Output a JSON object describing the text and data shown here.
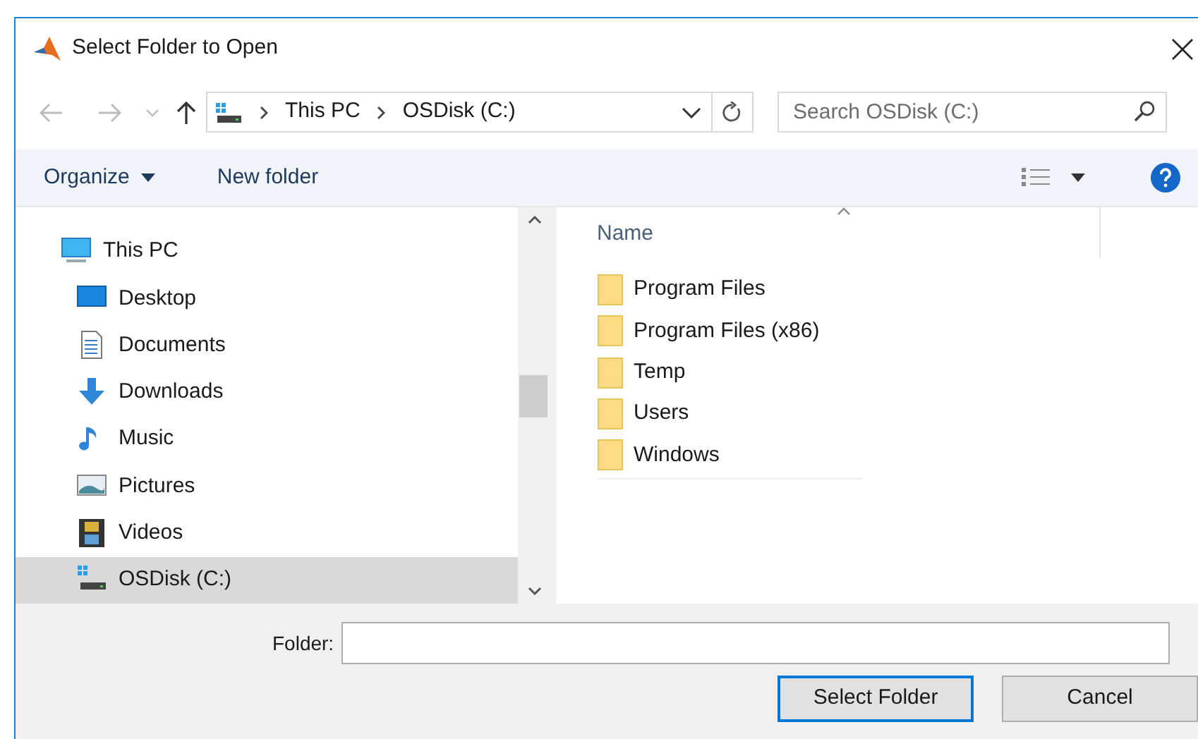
{
  "window": {
    "title": "Select Folder to Open"
  },
  "address_bar": {
    "path": [
      {
        "label": "This PC"
      },
      {
        "label": "OSDisk (C:)"
      }
    ]
  },
  "search": {
    "placeholder": "Search OSDisk (C:)"
  },
  "toolbar": {
    "buttons": [
      {
        "label": "Organize",
        "kind": "menu"
      },
      {
        "label": "New folder",
        "kind": "plain"
      }
    ]
  },
  "sidebar": {
    "items": [
      {
        "label": "This PC",
        "kind": "pc",
        "selected": false,
        "children": [
          {
            "label": "Desktop",
            "kind": "desktop",
            "selected": false
          },
          {
            "label": "Documents",
            "kind": "documents",
            "selected": false
          },
          {
            "label": "Downloads",
            "kind": "downloads",
            "selected": false
          },
          {
            "label": "Music",
            "kind": "music",
            "selected": false
          },
          {
            "label": "Pictures",
            "kind": "pictures",
            "selected": false
          },
          {
            "label": "Videos",
            "kind": "videos",
            "selected": false
          },
          {
            "label": "OSDisk (C:)",
            "kind": "disk",
            "selected": true
          }
        ]
      }
    ]
  },
  "file_list": {
    "columns": [
      "Name"
    ],
    "rows": [
      {
        "name": "Program Files"
      },
      {
        "name": "Program Files (x86)"
      },
      {
        "name": "Temp"
      },
      {
        "name": "Users"
      },
      {
        "name": "Windows"
      }
    ]
  },
  "folder_field": {
    "label": "Folder:"
  },
  "buttons": [
    {
      "label": "Select Folder",
      "default": true
    },
    {
      "label": "Cancel",
      "default": false
    }
  ]
}
